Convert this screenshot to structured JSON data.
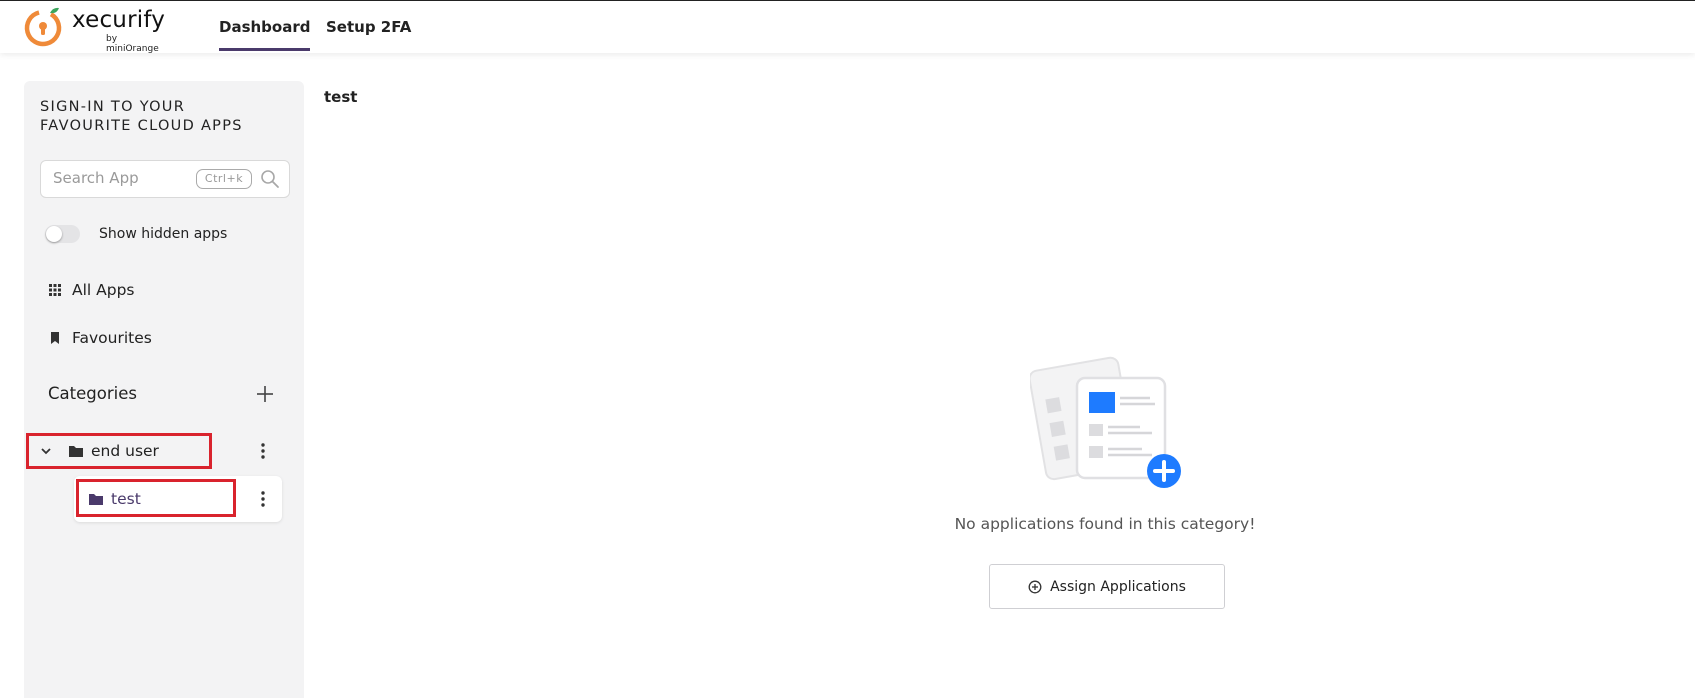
{
  "brand": {
    "name": "xecurify",
    "sub": "by miniOrange",
    "colors": {
      "orange": "#ef8a39",
      "green": "#3ba55c",
      "accent": "#4a3a6b",
      "blue": "#1e7bff",
      "highlight": "#d9232d"
    }
  },
  "header": {
    "tabs": [
      {
        "label": "Dashboard",
        "active": true
      },
      {
        "label": "Setup 2FA",
        "active": false
      }
    ]
  },
  "sidebar": {
    "title": "SIGN-IN TO YOUR FAVOURITE CLOUD APPS",
    "search": {
      "placeholder": "Search App",
      "shortcut": "Ctrl+k",
      "icon": "search-icon"
    },
    "toggle": {
      "label": "Show hidden apps",
      "on": false
    },
    "items": [
      {
        "label": "All Apps",
        "icon": "grid-icon"
      },
      {
        "label": "Favourites",
        "icon": "bookmark-icon"
      }
    ],
    "categories": {
      "label": "Categories",
      "add_icon": "plus-icon",
      "tree": [
        {
          "label": "end user",
          "icon": "folder-icon",
          "expanded": true,
          "children": [
            {
              "label": "test",
              "icon": "folder-icon"
            }
          ]
        }
      ]
    }
  },
  "main": {
    "title": "test",
    "empty_message": "No applications found in this category!",
    "assign_button": {
      "label": "Assign Applications",
      "icon": "plus-circle-icon"
    }
  }
}
